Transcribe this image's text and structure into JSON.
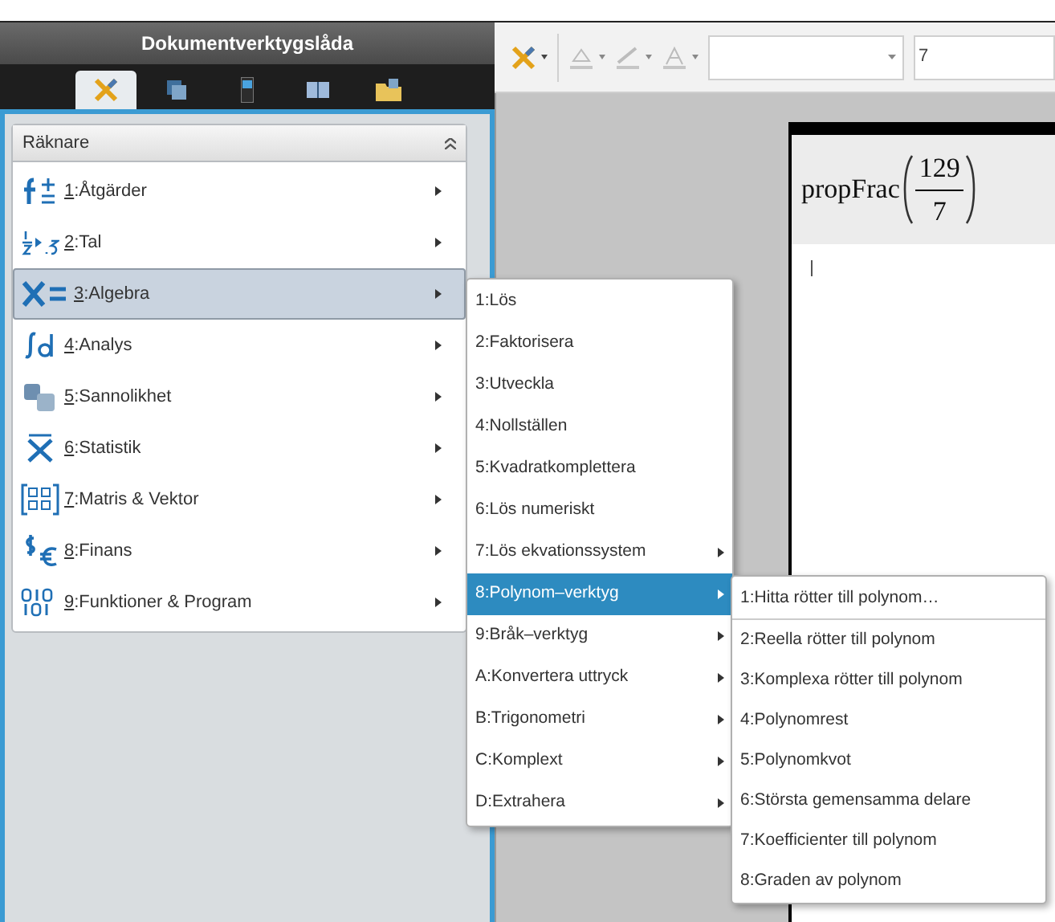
{
  "sidebar": {
    "title": "Dokumentverktygslåda",
    "tabs": [
      {
        "selected": true
      },
      {
        "selected": false
      },
      {
        "selected": false
      },
      {
        "selected": false
      },
      {
        "selected": false
      }
    ],
    "panel": {
      "title": "Räknare",
      "expanded": true,
      "items": [
        {
          "text": "1:Åtgärder",
          "selected": false
        },
        {
          "text": "2:Tal",
          "selected": false
        },
        {
          "text": "3:Algebra",
          "selected": true
        },
        {
          "text": "4:Analys",
          "selected": false
        },
        {
          "text": "5:Sannolikhet",
          "selected": false
        },
        {
          "text": "6:Statistik",
          "selected": false
        },
        {
          "text": "7:Matris & Vektor",
          "selected": false
        },
        {
          "text": "8:Finans",
          "selected": false
        },
        {
          "text": "9:Funktioner & Program",
          "selected": false
        }
      ]
    }
  },
  "submenu": {
    "items": [
      {
        "text": "1:Lös",
        "has_submenu": false,
        "selected": false
      },
      {
        "text": "2:Faktorisera",
        "has_submenu": false,
        "selected": false
      },
      {
        "text": "3:Utveckla",
        "has_submenu": false,
        "selected": false
      },
      {
        "text": "4:Nollställen",
        "has_submenu": false,
        "selected": false
      },
      {
        "text": "5:Kvadratkomplettera",
        "has_submenu": false,
        "selected": false
      },
      {
        "text": "6:Lös numeriskt",
        "has_submenu": false,
        "selected": false
      },
      {
        "text": "7:Lös ekvationssystem",
        "has_submenu": true,
        "selected": false
      },
      {
        "text": "8:Polynom–verktyg",
        "has_submenu": true,
        "selected": true
      },
      {
        "text": "9:Bråk–verktyg",
        "has_submenu": true,
        "selected": false
      },
      {
        "text": "A:Konvertera uttryck",
        "has_submenu": true,
        "selected": false
      },
      {
        "text": "B:Trigonometri",
        "has_submenu": true,
        "selected": false
      },
      {
        "text": "C:Komplext",
        "has_submenu": true,
        "selected": false
      },
      {
        "text": "D:Extrahera",
        "has_submenu": true,
        "selected": false
      }
    ]
  },
  "polynom_menu": {
    "items": [
      {
        "text": "1:Hitta rötter till polynom…",
        "separator_after": true
      },
      {
        "text": "2:Reella rötter till polynom",
        "separator_after": false
      },
      {
        "text": "3:Komplexa rötter till polynom",
        "separator_after": false
      },
      {
        "text": "4:Polynomrest",
        "separator_after": false
      },
      {
        "text": "5:Polynomkvot",
        "separator_after": false
      },
      {
        "text": "6:Största gemensamma delare",
        "separator_after": false
      },
      {
        "text": "7:Koefficienter till polynom",
        "separator_after": false
      },
      {
        "text": "8:Graden av polynom",
        "separator_after": false
      }
    ]
  },
  "toolbar": {
    "font_size": "7"
  },
  "document": {
    "function": "propFrac",
    "numerator": "129",
    "denominator": "7"
  }
}
